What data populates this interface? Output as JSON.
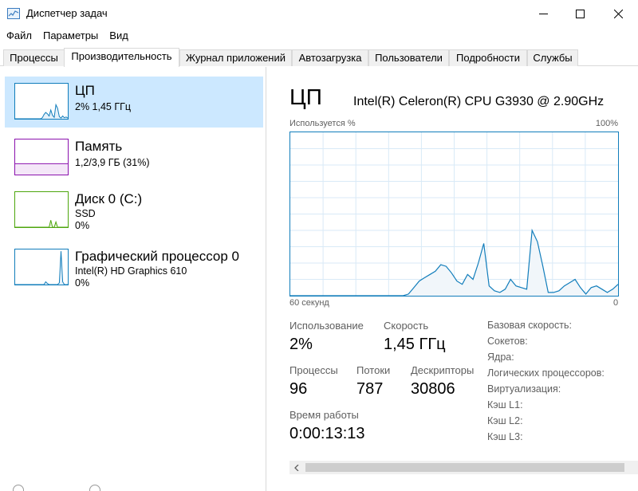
{
  "window": {
    "title": "Диспетчер задач"
  },
  "menu": [
    "Файл",
    "Параметры",
    "Вид"
  ],
  "tabs": [
    {
      "label": "Процессы"
    },
    {
      "label": "Производительность"
    },
    {
      "label": "Журнал приложений"
    },
    {
      "label": "Автозагрузка"
    },
    {
      "label": "Пользователи"
    },
    {
      "label": "Подробности"
    },
    {
      "label": "Службы"
    }
  ],
  "resources": [
    {
      "title": "ЦП",
      "line1": "2% 1,45 ГГц",
      "line2": "",
      "color": "#117dbb"
    },
    {
      "title": "Память",
      "line1": "1,2/3,9 ГБ (31%)",
      "line2": "",
      "color": "#8b12ae"
    },
    {
      "title": "Диск 0 (C:)",
      "line1": "SSD",
      "line2": "0%",
      "color": "#4da60c"
    },
    {
      "title": "Графический процессор 0",
      "line1": "Intel(R) HD Graphics 610",
      "line2": "0%",
      "color": "#117dbb"
    }
  ],
  "detail": {
    "heading": "ЦП",
    "model": "Intel(R) Celeron(R) CPU G3930 @ 2.90GHz",
    "graph_label": "Используется %",
    "graph_max": "100%",
    "axis_left": "60 секунд",
    "axis_right": "0",
    "stats": {
      "usage_label": "Использование",
      "usage_value": "2%",
      "speed_label": "Скорость",
      "speed_value": "1,45 ГГц",
      "processes_label": "Процессы",
      "processes_value": "96",
      "threads_label": "Потоки",
      "threads_value": "787",
      "handles_label": "Дескрипторы",
      "handles_value": "30806",
      "uptime_label": "Время работы",
      "uptime_value": "0:00:13:13"
    },
    "specs": [
      "Базовая скорость:",
      "Сокетов:",
      "Ядра:",
      "Логических процессоров:",
      "Виртуализация:",
      "Кэш L1:",
      "Кэш L2:",
      "Кэш L3:"
    ]
  },
  "cpu_history": [
    0,
    0,
    0,
    0,
    0,
    0,
    0,
    0,
    0,
    0,
    0,
    0,
    0,
    0,
    0,
    0,
    0,
    0,
    0,
    0,
    0,
    0,
    1,
    5,
    9,
    11,
    13,
    15,
    19,
    18,
    14,
    9,
    7,
    13,
    10,
    20,
    32,
    6,
    3,
    2,
    4,
    10,
    6,
    5,
    4,
    40,
    33,
    18,
    2,
    2,
    3,
    6,
    8,
    10,
    5,
    1,
    5,
    6,
    4,
    2,
    4,
    7
  ],
  "thumb_cpu": [
    0,
    0,
    0,
    0,
    0,
    0,
    0,
    0,
    0,
    0,
    0,
    0,
    0,
    0,
    0,
    0,
    3,
    12,
    18,
    14,
    8,
    25,
    10,
    4,
    40,
    30,
    6,
    2,
    8,
    3,
    5,
    2
  ],
  "thumb_gpu": [
    0,
    0,
    0,
    0,
    0,
    0,
    0,
    0,
    0,
    0,
    0,
    0,
    0,
    0,
    0,
    0,
    0,
    0,
    8,
    3,
    0,
    0,
    0,
    0,
    0,
    0,
    5,
    95,
    8,
    0,
    0,
    0
  ],
  "thumb_disk": [
    0,
    0,
    0,
    0,
    0,
    0,
    0,
    0,
    0,
    0,
    0,
    0,
    0,
    0,
    0,
    0,
    0,
    0,
    0,
    0,
    0,
    20,
    0,
    0,
    15,
    0,
    0,
    0,
    0,
    0,
    0,
    0
  ],
  "thumb_mem": 31
}
